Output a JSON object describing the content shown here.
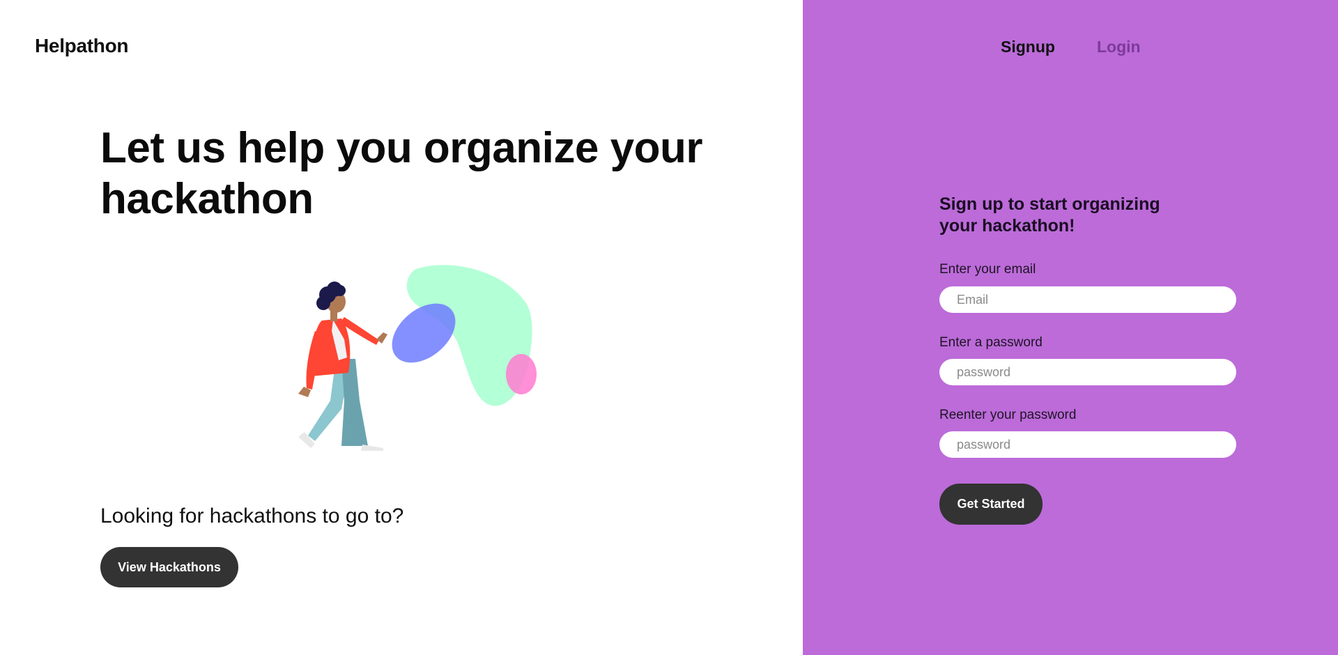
{
  "header": {
    "brand": "Helpathon",
    "nav": {
      "signup_label": "Signup",
      "login_label": "Login"
    }
  },
  "hero": {
    "title": "Let us help you organize your hackathon",
    "illustration_icon": "person-walking-with-shapes-illustration",
    "looking_text": "Looking for hackathons to go to?",
    "view_button_label": "View Hackathons"
  },
  "signup_form": {
    "heading": "Sign up to start organizing your hackathon!",
    "email_label": "Enter your email",
    "email_placeholder": "Email",
    "email_value": "",
    "password_label": "Enter a password",
    "password_placeholder": "password",
    "password_value": "",
    "reenter_label": "Reenter your password",
    "reenter_placeholder": "password",
    "reenter_value": "",
    "submit_label": "Get Started"
  },
  "colors": {
    "right_panel_bg": "#bc6bd9",
    "button_bg": "#333333",
    "login_link": "#7d3a99"
  }
}
